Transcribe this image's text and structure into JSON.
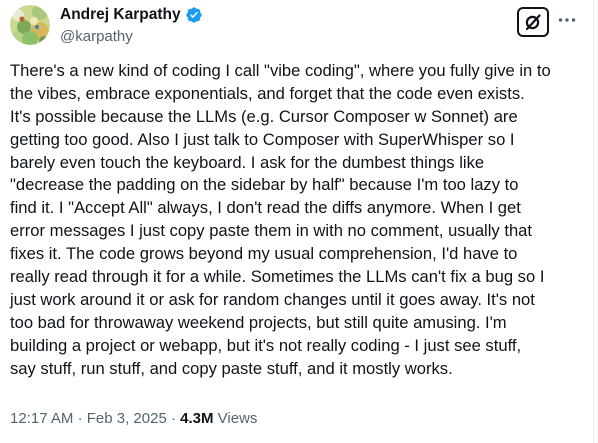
{
  "author": {
    "display_name": "Andrej Karpathy",
    "handle": "@karpathy",
    "verified": true,
    "verified_color": "#1d9bf0"
  },
  "actions": {
    "grok_icon": "grok-icon",
    "more_icon": "more-horizontal-icon"
  },
  "tweet": {
    "lines": [
      "There's a new kind of coding I call \"vibe coding\", where you fully give in to",
      "the vibes, embrace exponentials, and forget that the code even exists.",
      "It's possible because the LLMs (e.g. Cursor Composer w Sonnet) are",
      "getting too good. Also I just talk to Composer with SuperWhisper so I",
      "barely even touch the keyboard. I ask for the dumbest things like",
      "\"decrease the padding on the sidebar by half\" because I'm too lazy to",
      "find it. I \"Accept All\" always, I don't read the diffs anymore. When I get",
      "error messages I just copy paste them in with no comment, usually that",
      "fixes it. The code grows beyond my usual comprehension, I'd have to",
      "really read through it for a while. Sometimes the LLMs can't fix a bug so I",
      "just work around it or ask for random changes until it goes away. It's not",
      "too bad for throwaway weekend projects, but still quite amusing. I'm",
      "building a project or webapp, but it's not really coding - I just see stuff,",
      "say stuff, run stuff, and copy paste stuff, and it mostly works."
    ]
  },
  "meta": {
    "time": "12:17 AM",
    "separator": "·",
    "date": "Feb 3, 2025",
    "views_count": "4.3M",
    "views_label": "Views"
  },
  "colors": {
    "text": "#0f1419",
    "secondary": "#536471",
    "border": "#e6e9eb",
    "verified": "#1d9bf0"
  }
}
